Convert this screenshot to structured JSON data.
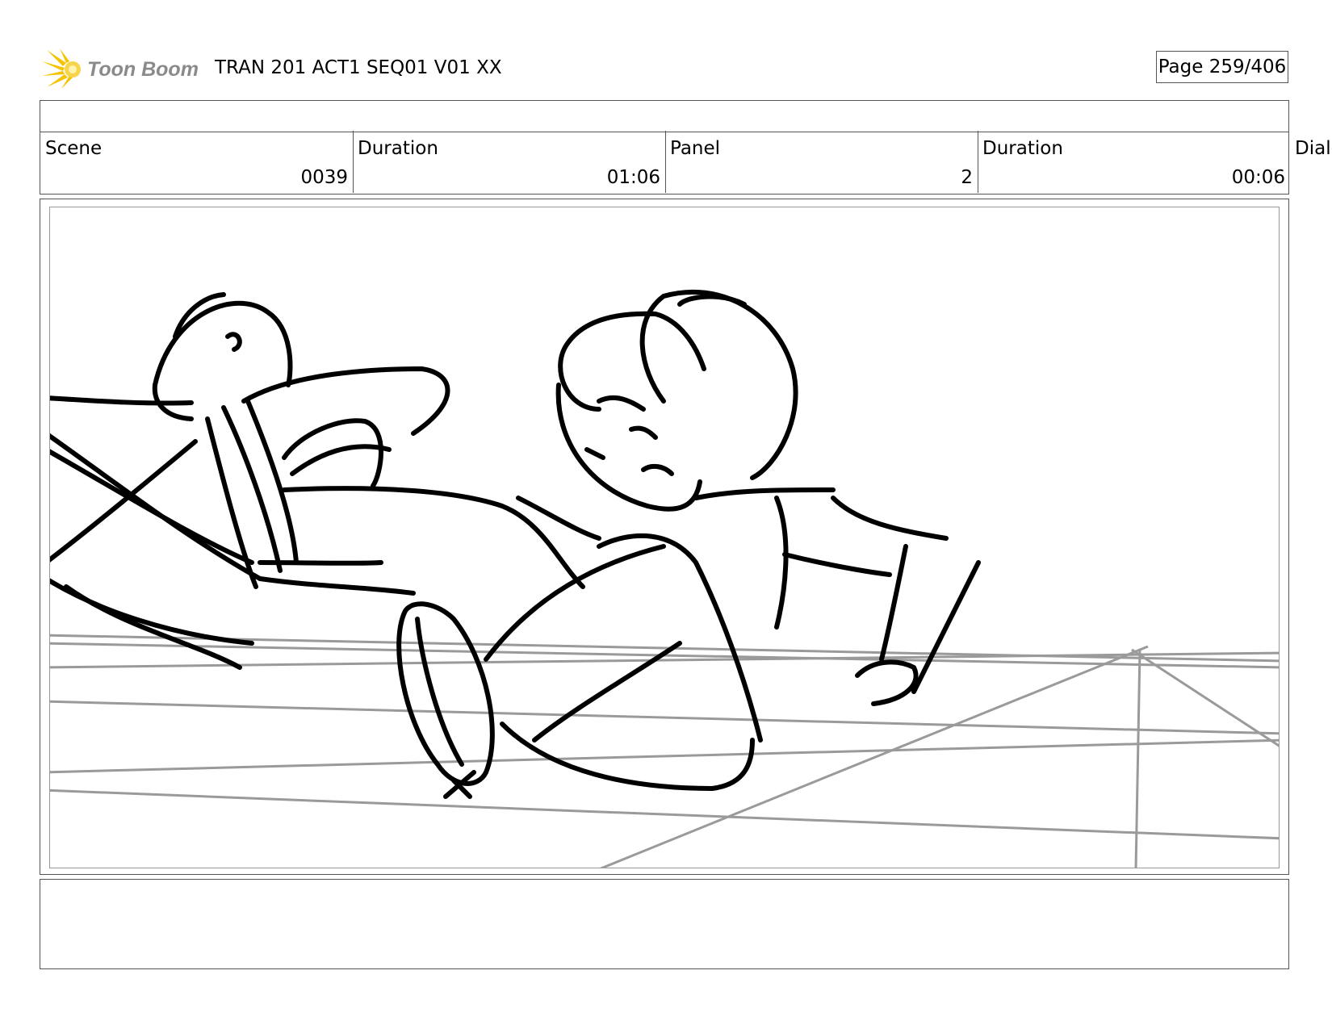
{
  "header": {
    "logo_text": "Toon Boom",
    "title": "TRAN 201 ACT1 SEQ01 V01 XX",
    "page": "Page 259/406"
  },
  "info": {
    "scene_label": "Scene",
    "scene_value": "0039",
    "scene_duration_label": "Duration",
    "scene_duration_value": "01:06",
    "panel_label": "Panel",
    "panel_value": "2",
    "panel_duration_label": "Duration",
    "panel_duration_value": "00:06",
    "dialog_label": "Dialog"
  },
  "colors": {
    "logo_accent": "#f5c400",
    "logo_text": "#8a8a8a",
    "border": "#555555"
  }
}
